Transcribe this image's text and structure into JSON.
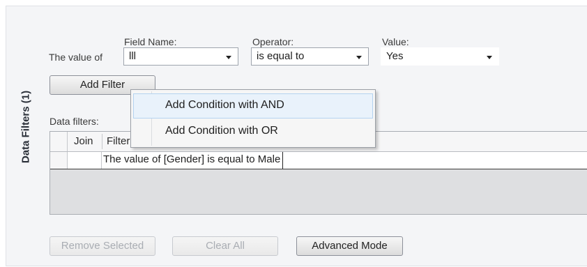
{
  "side_tab": {
    "label": "Data Filters (1)"
  },
  "filter_builder": {
    "value_of_label": "The value of",
    "field_name": {
      "label": "Field Name:",
      "value": "lll"
    },
    "operator": {
      "label": "Operator:",
      "value": "is equal to"
    },
    "value": {
      "label": "Value:",
      "value": "Yes"
    },
    "add_filter_label": "Add Filter"
  },
  "context_menu": {
    "items": [
      {
        "label": "Add Condition with AND",
        "highlighted": true
      },
      {
        "label": "Add Condition with OR",
        "highlighted": false
      }
    ]
  },
  "data_filters": {
    "label": "Data filters:",
    "columns": [
      "Join",
      "Filter"
    ],
    "rows": [
      {
        "join": "",
        "filter": "The value of [Gender] is equal to Male"
      }
    ]
  },
  "actions": {
    "remove_selected": "Remove Selected",
    "clear_all": "Clear All",
    "advanced_mode": "Advanced Mode"
  },
  "colors": {
    "panel_background": "#f4f5f7",
    "menu_highlight": "#e9f2fb",
    "menu_highlight_border": "#b4d3f0"
  }
}
